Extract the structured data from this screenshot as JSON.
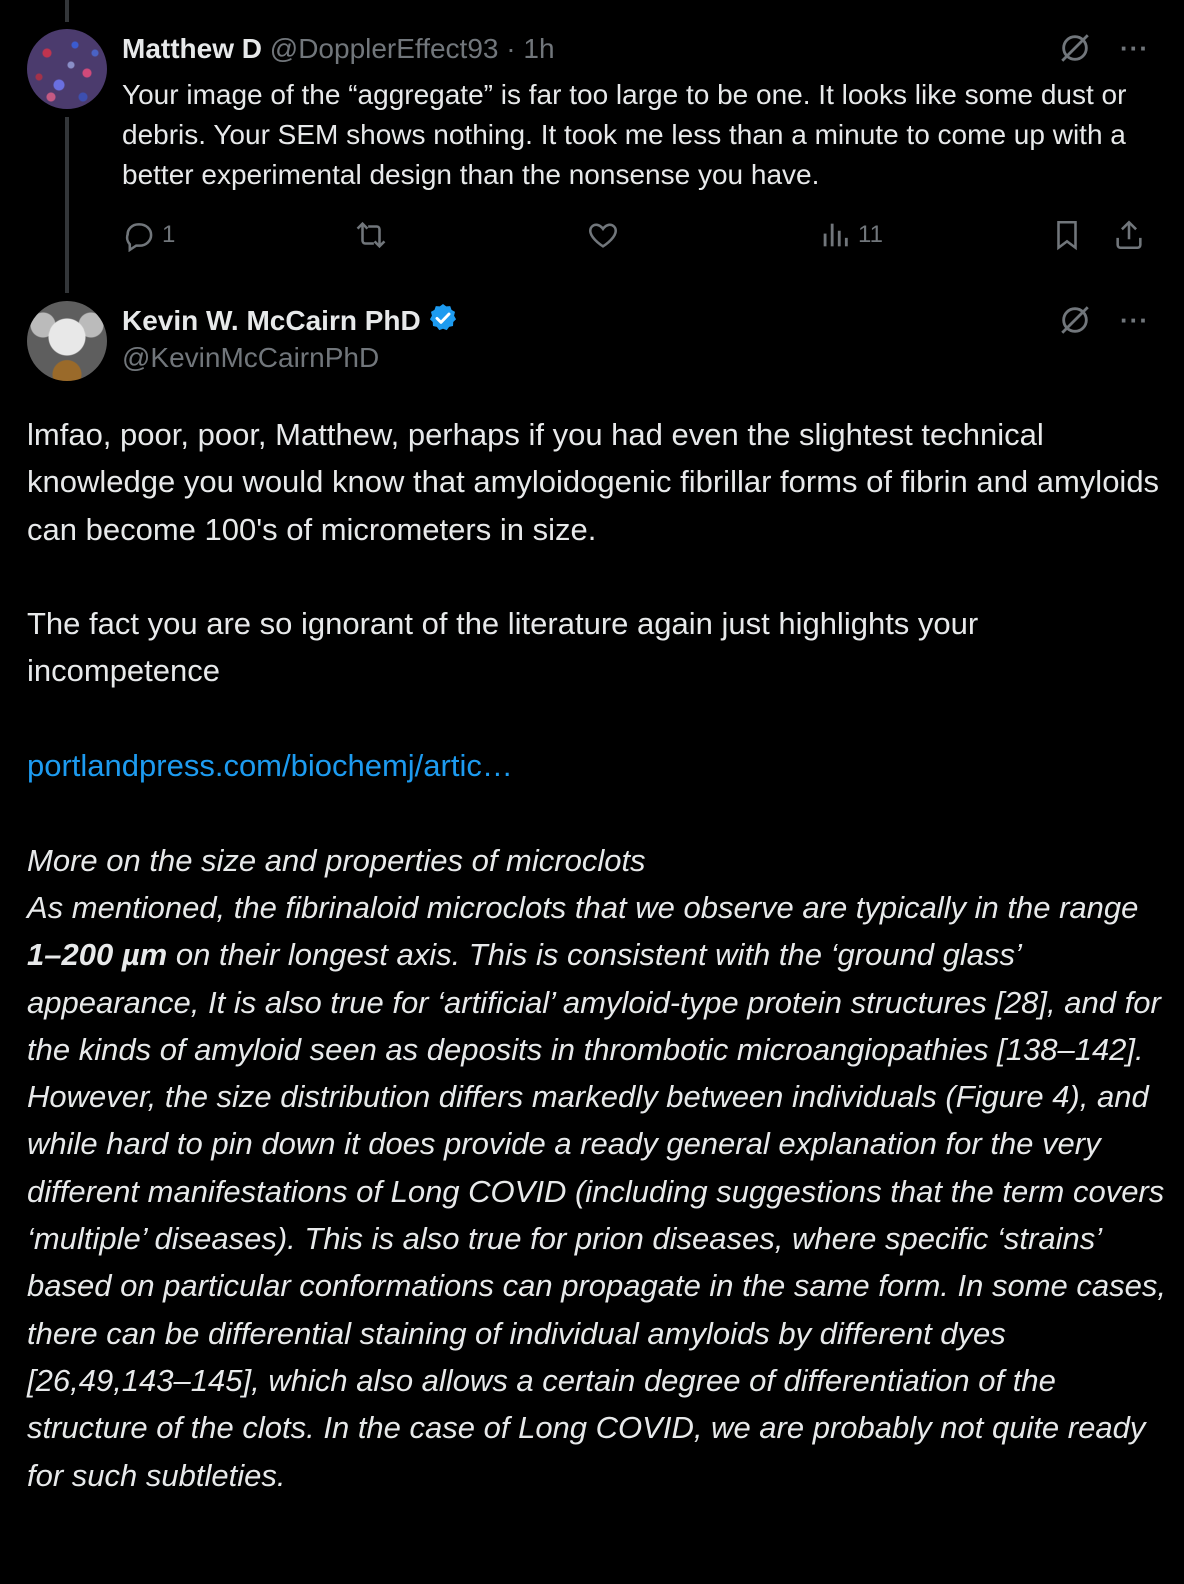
{
  "reply": {
    "name": "Matthew D",
    "handle": "@DopplerEffect93",
    "separator": "·",
    "time": "1h",
    "text": "Your image of the “aggregate” is far too large to be one. It looks like some dust or debris. Your SEM shows nothing. It took me less than a minute to come up with a better experimental design than the nonsense you have.",
    "actions": {
      "reply_count": "1",
      "repost_count": "",
      "like_count": "",
      "views_count": "11"
    },
    "more_label": "···"
  },
  "main": {
    "name": "Kevin W. McCairn PhD",
    "handle": "@KevinMcCairnPhD",
    "verified": true,
    "more_label": "···",
    "para1": "lmfao, poor, poor, Matthew, perhaps if you had even the slightest technical knowledge you would know that amyloidogenic fibrillar forms of fibrin and amyloids can become 100's of micrometers in size.",
    "para2": "The fact you are so ignorant of the literature again just highlights your incompetence",
    "link": "portlandpress.com/biochemj/artic…",
    "quote_heading": "More on the size and properties of microclots",
    "quote_a": "As mentioned, the fibrinaloid microclots that we observe are typically in the range ",
    "quote_bold": "1–200 µm",
    "quote_b": " on their longest axis. This is consistent with the ‘ground glass’ appearance, It is also true for ‘artificial’ amyloid-type protein structures [28], and for the kinds of amyloid seen as deposits in thrombotic microangiopathies [138–142]. However, the size distribution differs markedly between individuals (Figure 4), and while hard to pin down it does provide a ready general explanation for the very different manifestations of Long COVID (including suggestions that the term covers ‘multiple’ diseases). This is also true for prion diseases, where specific ‘strains’ based on particular conformations can propagate in the same form. In some cases, there can be differential staining of individual amyloids by different dyes [26,49,143–145], which also allows a certain degree of differentiation of the structure of the clots. In the case of Long COVID, we are probably not quite ready for such subtleties."
  },
  "colors": {
    "background": "#000000",
    "text": "#e7e9ea",
    "muted": "#71767b",
    "link": "#1d9bf0",
    "verified": "#1d9bf0",
    "thread_line": "#333639"
  },
  "icons": [
    "grok-icon",
    "more-icon",
    "reply-icon",
    "repost-icon",
    "like-icon",
    "views-icon",
    "bookmark-icon",
    "share-icon",
    "verified-badge-icon"
  ]
}
